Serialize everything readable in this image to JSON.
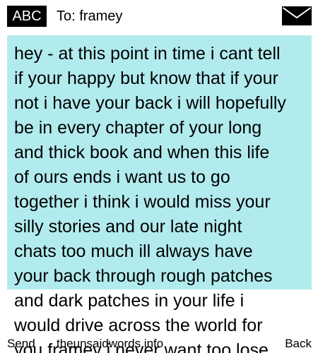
{
  "header": {
    "mode": "ABC",
    "to_label": "To: framey",
    "icon": "envelope-icon"
  },
  "message": {
    "text": "hey - at this point in time i cant tell\nif your happy but know that if your\nnot i have your back i will hopefully\nbe in every chapter of your long\nand thick book and when this life\nof ours ends i want us to go\ntogether i think i would miss your\nsilly stories and our late night\nchats too much ill always have\nyour back through rough patches\nand dark patches in your life i\nwould drive across the world for\nyou framey i never want too lose"
  },
  "softkeys": {
    "left": "Send",
    "center": "theunsaidwords.info",
    "right": "Back"
  },
  "colors": {
    "highlight": "#b2ebee",
    "badge_background": "#000000",
    "badge_text": "#ffffff"
  }
}
